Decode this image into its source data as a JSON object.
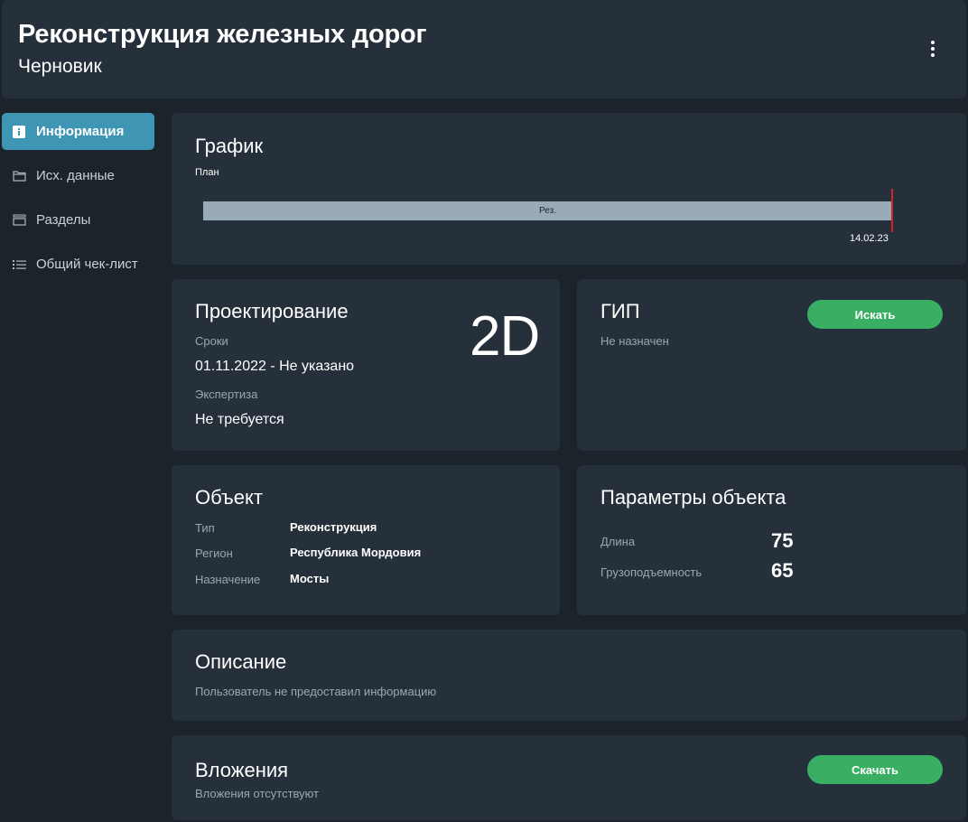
{
  "header": {
    "title": "Реконструкция железных дорог",
    "subtitle": "Черновик",
    "menu_icon": "more-vertical-icon"
  },
  "sidebar": {
    "items": [
      {
        "label": "Информация",
        "icon": "info-icon",
        "active": true
      },
      {
        "label": "Исх. данные",
        "icon": "folder-icon",
        "active": false
      },
      {
        "label": "Разделы",
        "icon": "sections-icon",
        "active": false
      },
      {
        "label": "Общий чек-лист",
        "icon": "list-icon",
        "active": false
      }
    ]
  },
  "schedule": {
    "title": "График",
    "plan_label": "План",
    "bar_label": "Рез.",
    "end_date": "14.02.23",
    "colors": {
      "bar": "#9aabb8",
      "marker": "#d2232a"
    }
  },
  "design": {
    "title": "Проектирование",
    "badge": "2D",
    "dates_label": "Сроки",
    "dates_value": "01.11.2022 - Не указано",
    "expertise_label": "Экспертиза",
    "expertise_value": "Не требуется"
  },
  "gip": {
    "title": "ГИП",
    "status": "Не назначен",
    "button": "Искать"
  },
  "object": {
    "title": "Объект",
    "rows": [
      {
        "label": "Тип",
        "value": "Реконструкция"
      },
      {
        "label": "Регион",
        "value": "Республика Мордовия"
      },
      {
        "label": "Назначение",
        "value": "Мосты"
      }
    ]
  },
  "params": {
    "title": "Параметры объекта",
    "rows": [
      {
        "label": "Длина",
        "value": "75"
      },
      {
        "label": "Грузоподъемность",
        "value": "65"
      }
    ]
  },
  "description": {
    "title": "Описание",
    "text": "Пользователь не предоставил информацию"
  },
  "attachments": {
    "title": "Вложения",
    "text": "Вложения отсутствуют",
    "button": "Скачать"
  },
  "colors": {
    "background": "#1b232b",
    "card": "#25303a",
    "accent": "#3f95b4",
    "button": "#3aaf63"
  }
}
